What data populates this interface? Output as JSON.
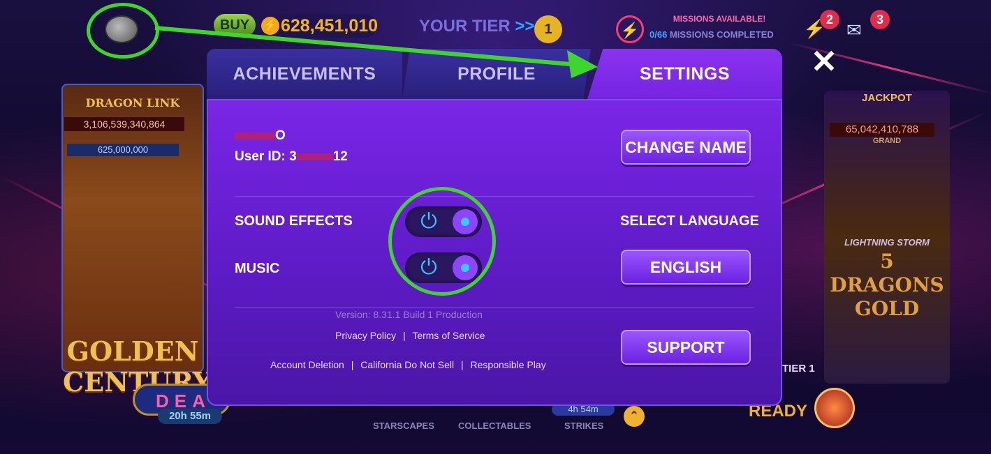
{
  "hud": {
    "buy_label": "BUY",
    "coins": "628,451,010",
    "tier_label": "YOUR TIER",
    "tier_arrows": ">>",
    "tier_number": "1",
    "missions_available": "MISSIONS AVAILABLE!",
    "missions_count": "0/66",
    "missions_completed": "MISSIONS COMPLETED",
    "notif_left": "2",
    "notif_right": "3"
  },
  "background": {
    "left_game_brand": "DRAGON LINK",
    "left_jackpot": "3,106,539,340,864",
    "left_minor": "625,000,000",
    "left_game_title": "GOLDEN CENTURY",
    "right_jackpot_label": "JACKPOT",
    "right_jackpot": "65,042,410,788",
    "right_grand": "GRAND",
    "right_game_brand": "LIGHTNING STORM",
    "right_game_title": "5 DRAGONS GOLD",
    "right_tier": "TIER 1",
    "deal_label": "DEA",
    "deal_timer": "20h 55m",
    "bonus_ready": "READY",
    "nav_starscapes": "STARSCAPES",
    "nav_collectables": "COLLECTABLES",
    "nav_strikes": "STRIKES",
    "strikes_timer": "4h 54m"
  },
  "modal": {
    "tabs": [
      {
        "label": "ACHIEVEMENTS",
        "active": false
      },
      {
        "label": "PROFILE",
        "active": false
      },
      {
        "label": "SETTINGS",
        "active": true
      }
    ],
    "user_name_visible": "O",
    "user_id_prefix": "User ID: 3",
    "user_id_suffix": "12",
    "change_name_button": "CHANGE NAME",
    "sound_effects_label": "SOUND EFFECTS",
    "sound_effects_on": true,
    "music_label": "MUSIC",
    "music_on": true,
    "select_language_label": "SELECT LANGUAGE",
    "language_value": "ENGLISH",
    "version": "Version: 8.31.1 Build 1 Production",
    "privacy_policy": "Privacy Policy",
    "terms_of_service": "Terms of Service",
    "account_deletion": "Account Deletion",
    "california_do_not_sell": "California Do Not Sell",
    "responsible_play": "Responsible Play",
    "separator": "|",
    "support_button": "SUPPORT",
    "close_icon": "close-icon"
  },
  "colors": {
    "panel": "#6a22e0",
    "tab_active": "#7c28e6",
    "tab_inactive": "#2e2488",
    "toggle_icon": "#38c6ff",
    "annotation": "#3ed62a"
  }
}
